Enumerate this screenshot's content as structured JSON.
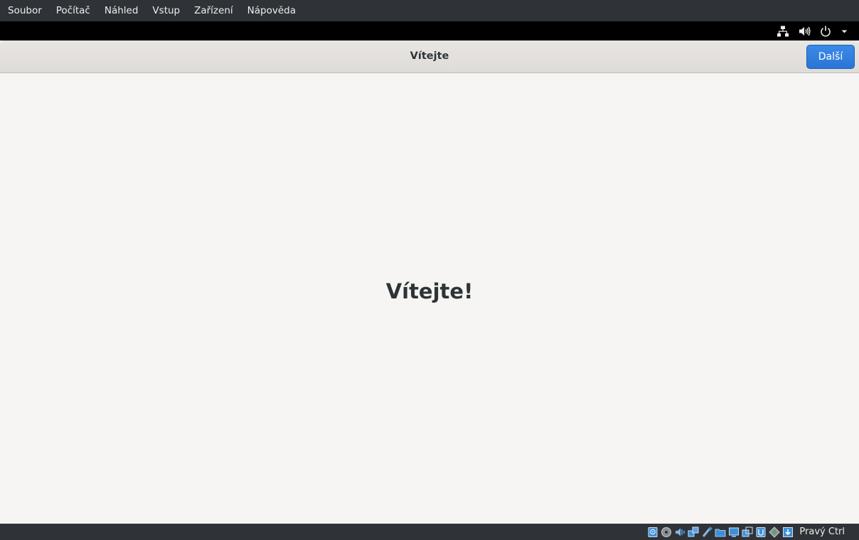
{
  "vbox_menu": {
    "items": [
      {
        "label": "Soubor"
      },
      {
        "label": "Počítač"
      },
      {
        "label": "Náhled"
      },
      {
        "label": "Vstup"
      },
      {
        "label": "Zařízení"
      },
      {
        "label": "Nápověda"
      }
    ]
  },
  "panel": {
    "status_icons": [
      "network-wired-icon",
      "volume-icon",
      "power-icon",
      "chevron-down-icon"
    ]
  },
  "headerbar": {
    "title": "Vítejte",
    "next_label": "Další"
  },
  "content": {
    "heading": "Vítejte!"
  },
  "statusbar": {
    "host_key": "Pravý Ctrl",
    "indicators": [
      "hard-disk-icon",
      "optical-drive-icon",
      "audio-icon",
      "network-icon",
      "usb-icon",
      "shared-folders-icon",
      "display-icon",
      "video-capture-icon",
      "mouse-integration-icon",
      "keyboard-capture-icon",
      "host-key-icon"
    ]
  },
  "colors": {
    "accent": "#3584e4",
    "menubar_bg": "#2f3337",
    "panel_bg": "#000000",
    "content_bg": "#f6f5f4"
  }
}
